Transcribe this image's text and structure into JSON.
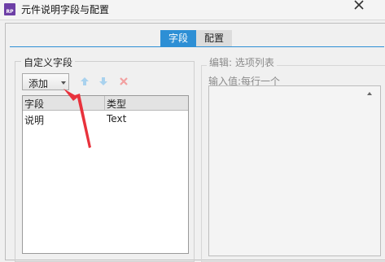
{
  "window": {
    "title": "元件说明字段与配置",
    "app_icon_text": "RP"
  },
  "tabs": [
    {
      "label": "字段",
      "active": true
    },
    {
      "label": "配置",
      "active": false
    }
  ],
  "custom_fields": {
    "legend": "自定义字段",
    "add_label": "添加",
    "columns": [
      "字段",
      "类型"
    ],
    "rows": [
      {
        "field": "说明",
        "type": "Text"
      }
    ]
  },
  "editor": {
    "legend": "编辑: 选项列表",
    "input_label": "输入值:每行一个",
    "value": ""
  },
  "colors": {
    "accent": "#2d8fd5",
    "annotation_arrow": "#e8323c",
    "disabled_icon": "#a9d2ee",
    "delete_icon": "#f2a0a0"
  }
}
